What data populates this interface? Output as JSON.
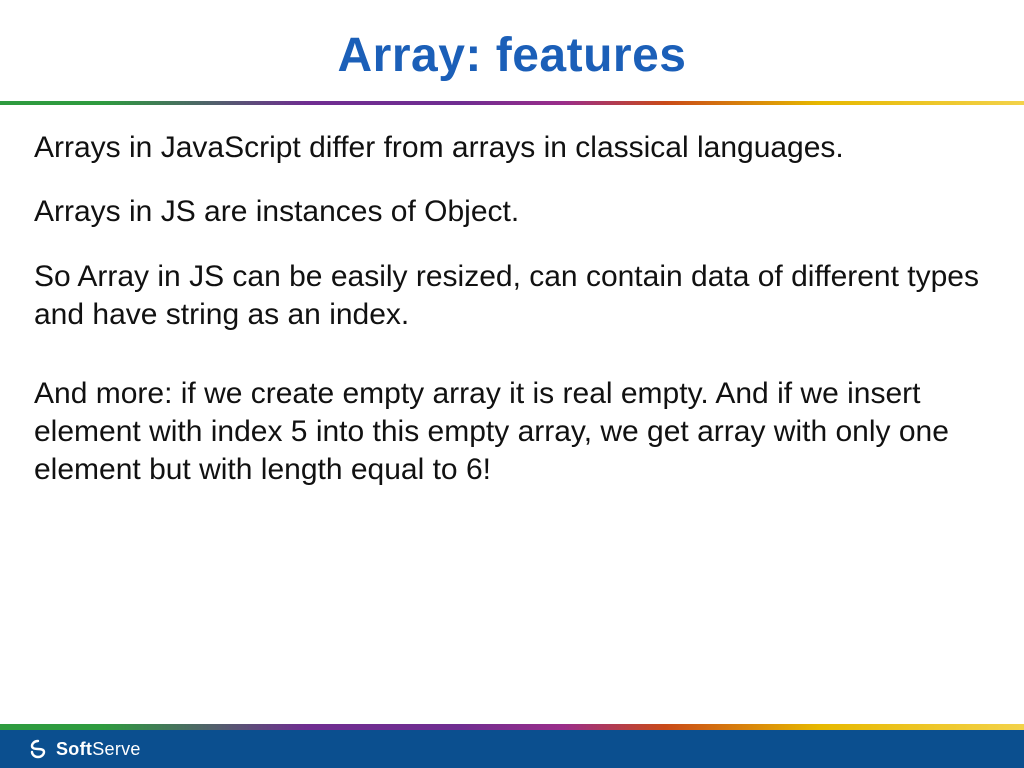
{
  "title": "Array: features",
  "paragraphs": {
    "p1": "Arrays in JavaScript differ from arrays in classical languages.",
    "p2": "Arrays in JS are instances of Object.",
    "p3": "So Array in JS can be easily resized, can contain data of different types and have string as an index.",
    "p4": "And more: if we create empty array it is real empty. And if we insert element with index 5 into this empty array, we get array with only one element but with length equal to 6!"
  },
  "footer": {
    "brand_strong": "Soft",
    "brand_light": "Serve"
  }
}
